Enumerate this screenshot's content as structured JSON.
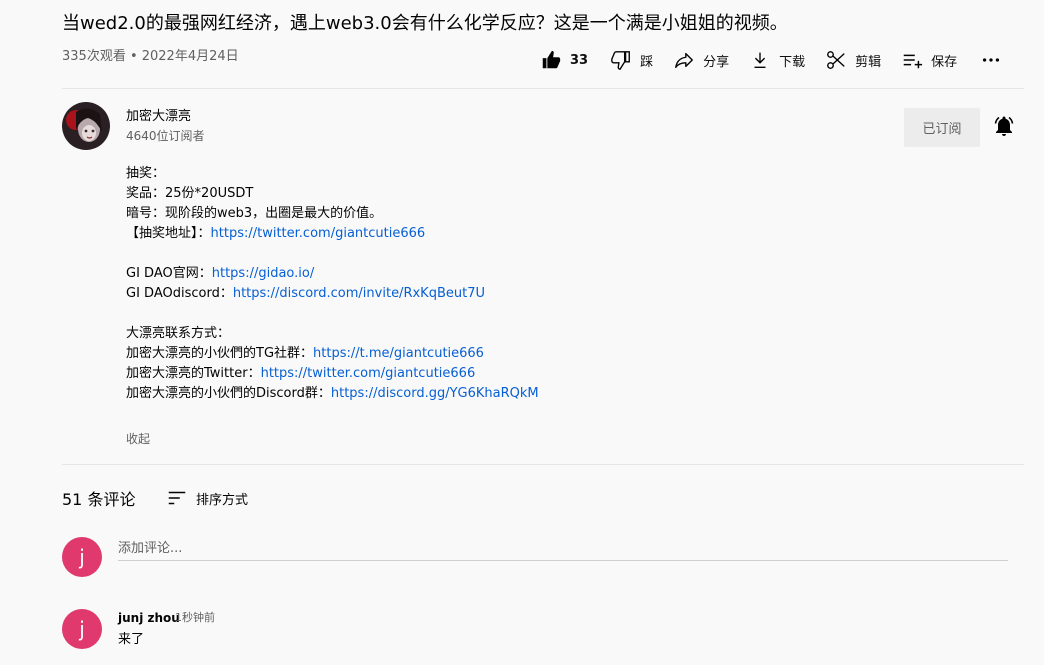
{
  "video": {
    "title": "当wed2.0的最强网红经济，遇上web3.0会有什么化学反应？这是一个满是小姐姐的视频。",
    "meta": "335次观看 • 2022年4月24日"
  },
  "actions": {
    "like_count": "33",
    "dislike_label": "踩",
    "share_label": "分享",
    "download_label": "下载",
    "clip_label": "剪辑",
    "save_label": "保存"
  },
  "channel": {
    "name": "加密大漂亮",
    "subscribers": "4640位订阅者",
    "subscribed_label": "已订阅"
  },
  "description": {
    "lines": [
      {
        "text": "抽奖：",
        "link": ""
      },
      {
        "text": "奖品：25份*20USDT",
        "link": ""
      },
      {
        "text": "暗号：现阶段的web3，出圈是最大的价值。",
        "link": ""
      },
      {
        "text": "【抽奖地址】：",
        "link": "https://twitter.com/giantcutie666"
      },
      {
        "text": "",
        "link": ""
      },
      {
        "text": "GI DAO官网：",
        "link": "https://gidao.io/"
      },
      {
        "text": "GI DAOdiscord：",
        "link": "https://discord.com/invite/RxKqBeut7U"
      },
      {
        "text": "",
        "link": ""
      },
      {
        "text": "大漂亮联系方式：",
        "link": ""
      },
      {
        "text": "加密大漂亮的小伙們的TG社群：",
        "link": "https://t.me/giantcutie666"
      },
      {
        "text": "加密大漂亮的Twitter：",
        "link": "https://twitter.com/giantcutie666"
      },
      {
        "text": "加密大漂亮的小伙們的Discord群：",
        "link": "https://discord.gg/YG6KhaRQkM"
      }
    ],
    "collapse_label": "收起"
  },
  "comments": {
    "count_label": "51 条评论",
    "sort_label": "排序方式",
    "input_placeholder": "添加评论...",
    "user_initial": "j",
    "items": [
      {
        "initial": "j",
        "author": "junj zhou",
        "time": "1秒钟前",
        "text": "来了"
      }
    ]
  },
  "colors": {
    "link": "#065fd4",
    "avatar": "#e0396d"
  }
}
